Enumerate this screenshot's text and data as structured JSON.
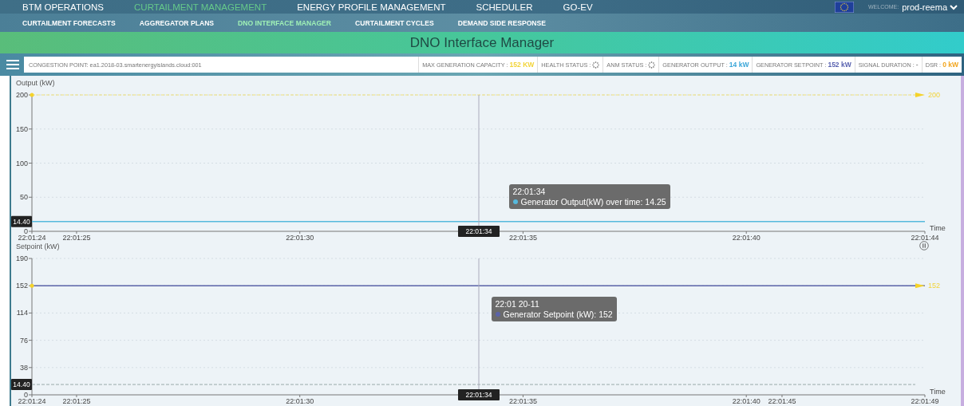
{
  "main_nav": {
    "items": [
      {
        "label": "BTM OPERATIONS",
        "selected": false
      },
      {
        "label": "CURTAILMENT MANAGEMENT",
        "selected": true
      },
      {
        "label": "ENERGY PROFILE MANAGEMENT",
        "selected": false
      },
      {
        "label": "SCHEDULER",
        "selected": false
      },
      {
        "label": "GO-EV",
        "selected": false
      }
    ],
    "welcome": "WELCOME:",
    "user": "prod-reema"
  },
  "sub_nav": {
    "items": [
      {
        "label": "CURTAILMENT FORECASTS",
        "selected": false
      },
      {
        "label": "AGGREGATOR PLANS",
        "selected": false
      },
      {
        "label": "DNO INTERFACE MANAGER",
        "selected": true
      },
      {
        "label": "CURTAILMENT CYCLES",
        "selected": false
      },
      {
        "label": "DEMAND SIDE RESPONSE",
        "selected": false
      }
    ]
  },
  "page_title": "DNO Interface Manager",
  "info_bar": {
    "congestion_point": "CONGESTION POINT: ea1.2018-03.smartenergyislands.cloud:001",
    "items": [
      {
        "kind": "text",
        "label": "MAX GENERATION CAPACITY :",
        "value": "152 KW",
        "color": "#f2d43a"
      },
      {
        "kind": "spinner",
        "label": "HEALTH STATUS :"
      },
      {
        "kind": "spinner",
        "label": "ANM STATUS :"
      },
      {
        "kind": "text",
        "label": "GENERATOR OUTPUT :",
        "value": "14 kW",
        "color": "#3aa6d8"
      },
      {
        "kind": "text",
        "label": "GENERATOR SETPOINT :",
        "value": "152 kW",
        "color": "#5a63b0"
      },
      {
        "kind": "text",
        "label": "SIGNAL DURATION :",
        "value": "-"
      },
      {
        "kind": "text",
        "label": "DSR :",
        "value": "0 kW",
        "color": "#f2a51e"
      }
    ]
  },
  "charts": [
    {
      "chart_data": {
        "type": "line",
        "ylabel": "Output (kW)",
        "xlabel": "Time",
        "grid": true,
        "categories": [
          "22:01:24",
          "22:01:25",
          "22:01:30",
          "22:01:35",
          "22:01:40",
          "22:01:44"
        ],
        "ylim": [
          0,
          200
        ],
        "yticks": [
          0,
          50,
          100,
          150,
          200
        ],
        "series": [
          {
            "color": "#56b9dd",
            "values": [
              14.25,
              14.25,
              14.25,
              14.25,
              14.25,
              14.25
            ]
          }
        ],
        "ref_lines": [
          {
            "axis": "y",
            "value": 200,
            "label": "200",
            "color": "#efe07a"
          }
        ]
      },
      "cursor": {
        "label": "22:01:34",
        "value_label": "14.40"
      },
      "tooltip": {
        "title": "22:01:34",
        "text": "Generator Output(kW) over time: 14.25"
      }
    },
    {
      "chart_data": {
        "type": "line",
        "ylabel": "Setpoint (kW)",
        "xlabel": "Time",
        "grid": true,
        "categories": [
          "22:01:24",
          "22:01:25",
          "22:01:30",
          "22:01:35",
          "22:01:40",
          "22:01:45",
          "22:01:49"
        ],
        "ylim": [
          0,
          190
        ],
        "yticks": [
          0,
          38,
          76,
          114,
          152,
          190
        ],
        "series": [
          {
            "color": "#5b63a8",
            "values": [
              152,
              152,
              152,
              152,
              152,
              152,
              152
            ]
          }
        ],
        "ref_lines": [
          {
            "axis": "y",
            "value": 14.4,
            "color": "#99aaaa"
          }
        ]
      },
      "end_label": "152",
      "cursor": {
        "label": "22:01:34",
        "value_label": "14.40"
      },
      "tooltip": {
        "title": "22:01 20-11",
        "text": "Generator Setpoint (kW): 152"
      }
    }
  ]
}
